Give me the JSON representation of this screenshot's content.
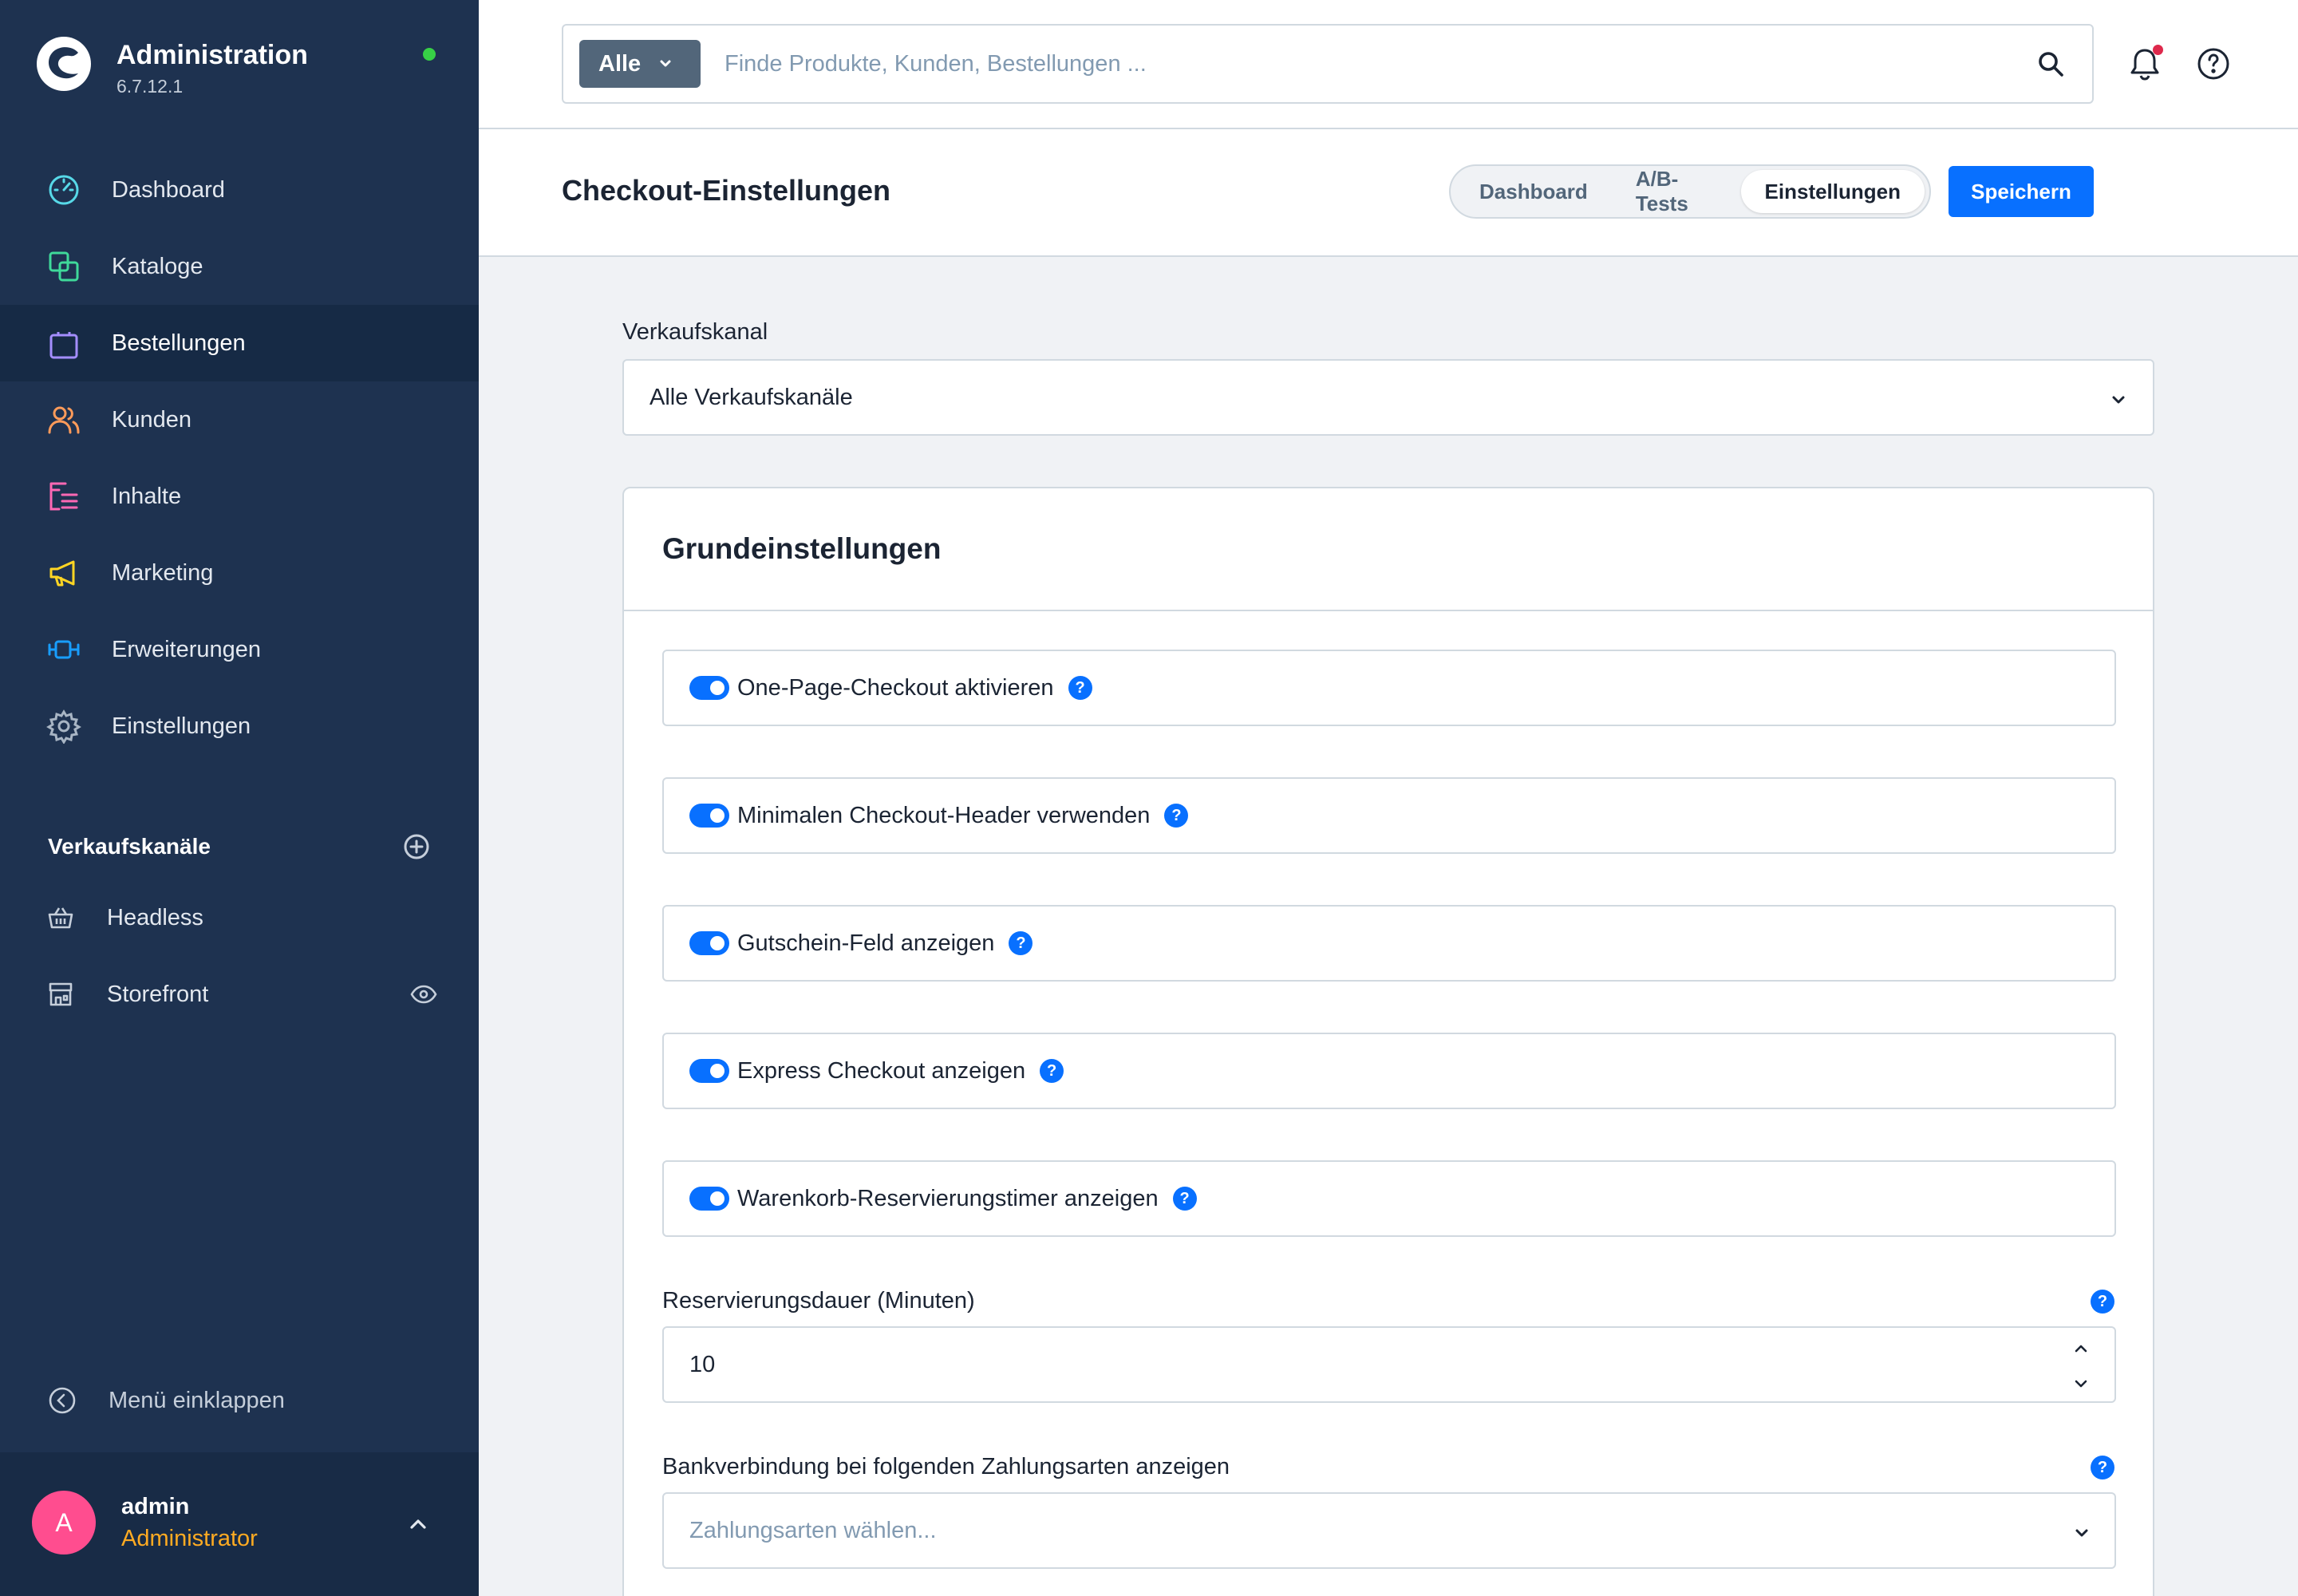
{
  "app": {
    "title": "Administration",
    "version": "6.7.12.1"
  },
  "nav": {
    "items": [
      {
        "label": "Dashboard",
        "icon": "gauge-icon",
        "color": "#57d9e8"
      },
      {
        "label": "Kataloge",
        "icon": "catalog-icon",
        "color": "#3fd99a"
      },
      {
        "label": "Bestellungen",
        "icon": "shopping-bag-icon",
        "color": "#a48eff",
        "active": true
      },
      {
        "label": "Kunden",
        "icon": "users-icon",
        "color": "#ff9b5a"
      },
      {
        "label": "Inhalte",
        "icon": "content-icon",
        "color": "#ff68b4"
      },
      {
        "label": "Marketing",
        "icon": "megaphone-icon",
        "color": "#ffd523"
      },
      {
        "label": "Erweiterungen",
        "icon": "plug-icon",
        "color": "#189eff"
      },
      {
        "label": "Einstellungen",
        "icon": "gear-icon",
        "color": "#a8b5c4"
      }
    ]
  },
  "sales_channels": {
    "title": "Verkaufskanäle",
    "items": [
      {
        "label": "Headless",
        "icon": "basket-icon"
      },
      {
        "label": "Storefront",
        "icon": "storefront-icon"
      }
    ]
  },
  "collapse_label": "Menü einklappen",
  "user": {
    "initial": "A",
    "name": "admin",
    "role": "Administrator"
  },
  "search": {
    "type_label": "Alle",
    "placeholder": "Finde Produkte, Kunden, Bestellungen ..."
  },
  "page": {
    "title": "Checkout-Einstellungen",
    "tabs": [
      {
        "label": "Dashboard"
      },
      {
        "label": "A/B-Tests"
      },
      {
        "label": "Einstellungen",
        "active": true
      }
    ],
    "save_label": "Speichern"
  },
  "sales_channel_field": {
    "label": "Verkaufskanal",
    "value": "Alle Verkaufskanäle"
  },
  "card": {
    "title": "Grundeinstellungen",
    "toggles": [
      {
        "label": "One-Page-Checkout aktivieren",
        "enabled": true
      },
      {
        "label": "Minimalen Checkout-Header verwenden",
        "enabled": true
      },
      {
        "label": "Gutschein-Feld anzeigen",
        "enabled": true
      },
      {
        "label": "Express Checkout anzeigen",
        "enabled": true
      },
      {
        "label": "Warenkorb-Reservierungstimer anzeigen",
        "enabled": true
      }
    ],
    "reservation": {
      "label": "Reservierungsdauer (Minuten)",
      "value": "10"
    },
    "bank": {
      "label": "Bankverbindung bei folgenden Zahlungsarten anzeigen",
      "placeholder": "Zahlungsarten wählen..."
    }
  },
  "help_glyph": "?"
}
